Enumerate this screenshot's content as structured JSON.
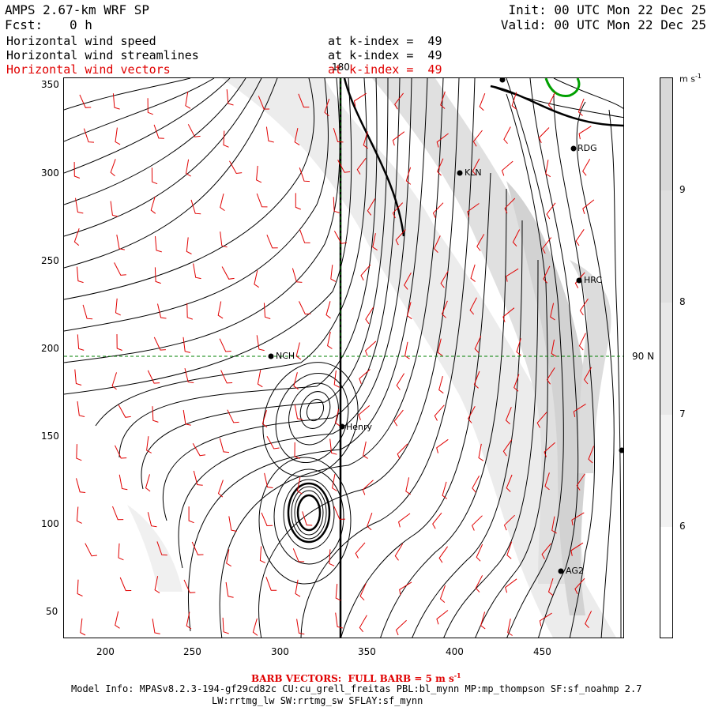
{
  "header": {
    "model_title": "AMPS 2.67-km WRF SP",
    "fcst_label": "Fcst:",
    "fcst_value": "0 h",
    "init": "Init: 00 UTC Mon 22 Dec 25",
    "valid": "Valid: 00 UTC Mon 22 Dec 25",
    "fields": [
      {
        "name": "Horizontal wind speed",
        "level": "at k-index =  49"
      },
      {
        "name": "Horizontal wind streamlines",
        "level": "at k-index =  49"
      },
      {
        "name": "Horizontal wind vectors",
        "level": "at k-index =  49"
      }
    ]
  },
  "axes": {
    "x_ticks": [
      "200",
      "250",
      "300",
      "350",
      "400",
      "450"
    ],
    "y_ticks": [
      "350",
      "300",
      "250",
      "200",
      "150",
      "100",
      "50"
    ],
    "meridian_label": "180",
    "lat_label": "90 N"
  },
  "colorbar": {
    "unit": "m s",
    "unit_exp": "-1",
    "labels": [
      "9",
      "8",
      "7",
      "6"
    ],
    "colors": [
      "#ffffff",
      "#f0f0f0",
      "#e4e4e4",
      "#d8d8d8",
      "#cccccc"
    ]
  },
  "stations": [
    {
      "name": "RDG"
    },
    {
      "name": "KLN"
    },
    {
      "name": "HRC"
    },
    {
      "name": "NCH"
    },
    {
      "name": "Henry"
    },
    {
      "name": "AG2"
    },
    {
      "name": ""
    }
  ],
  "footer": {
    "barb": "BARB VECTORS:  FULL BARB = 5 m s",
    "barb_exp": "-1",
    "model_info": "Model Info: MPASv8.2.3-194-gf29cd82c CU:cu_grell_freitas PBL:bl_mynn MP:mp_thompson SF:sf_noahmp 2.7",
    "model_info2": "LW:rrtmg_lw SW:rrtmg_sw SFLAY:sf_mynn"
  },
  "colors": {
    "barbs": "#e00000",
    "coast": "#00a000",
    "grid": "#008000"
  }
}
